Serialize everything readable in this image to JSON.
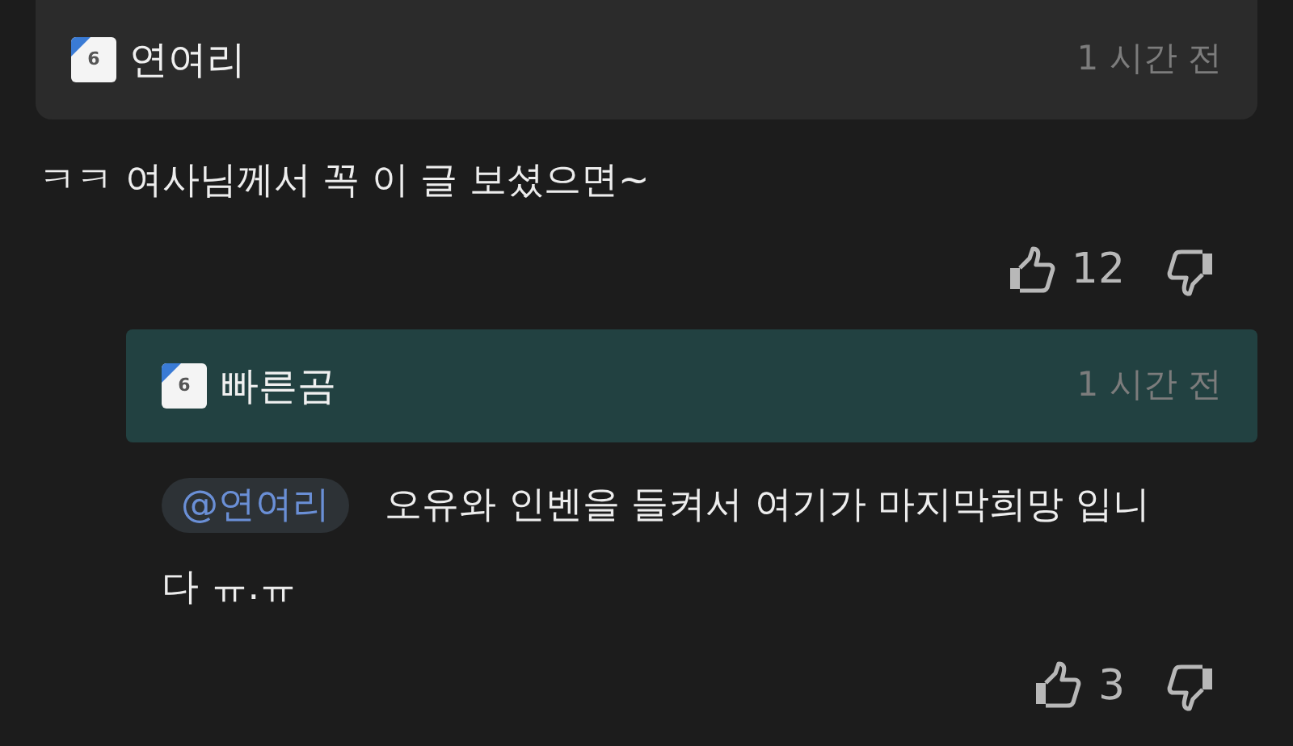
{
  "comments": [
    {
      "kind": "comment",
      "badge": "6",
      "author": "연여리",
      "time": "1 시간 전",
      "text": "ㅋㅋ 여사님께서 꼭 이 글 보셨으면~",
      "likes": "12"
    },
    {
      "kind": "reply",
      "badge": "6",
      "author": "빠른곰",
      "time": "1 시간 전",
      "mention": "@연여리",
      "text": "오유와 인벤을 들켜서 여기가 마지막희망 입니다 ㅠ.ㅠ",
      "likes": "3"
    }
  ]
}
